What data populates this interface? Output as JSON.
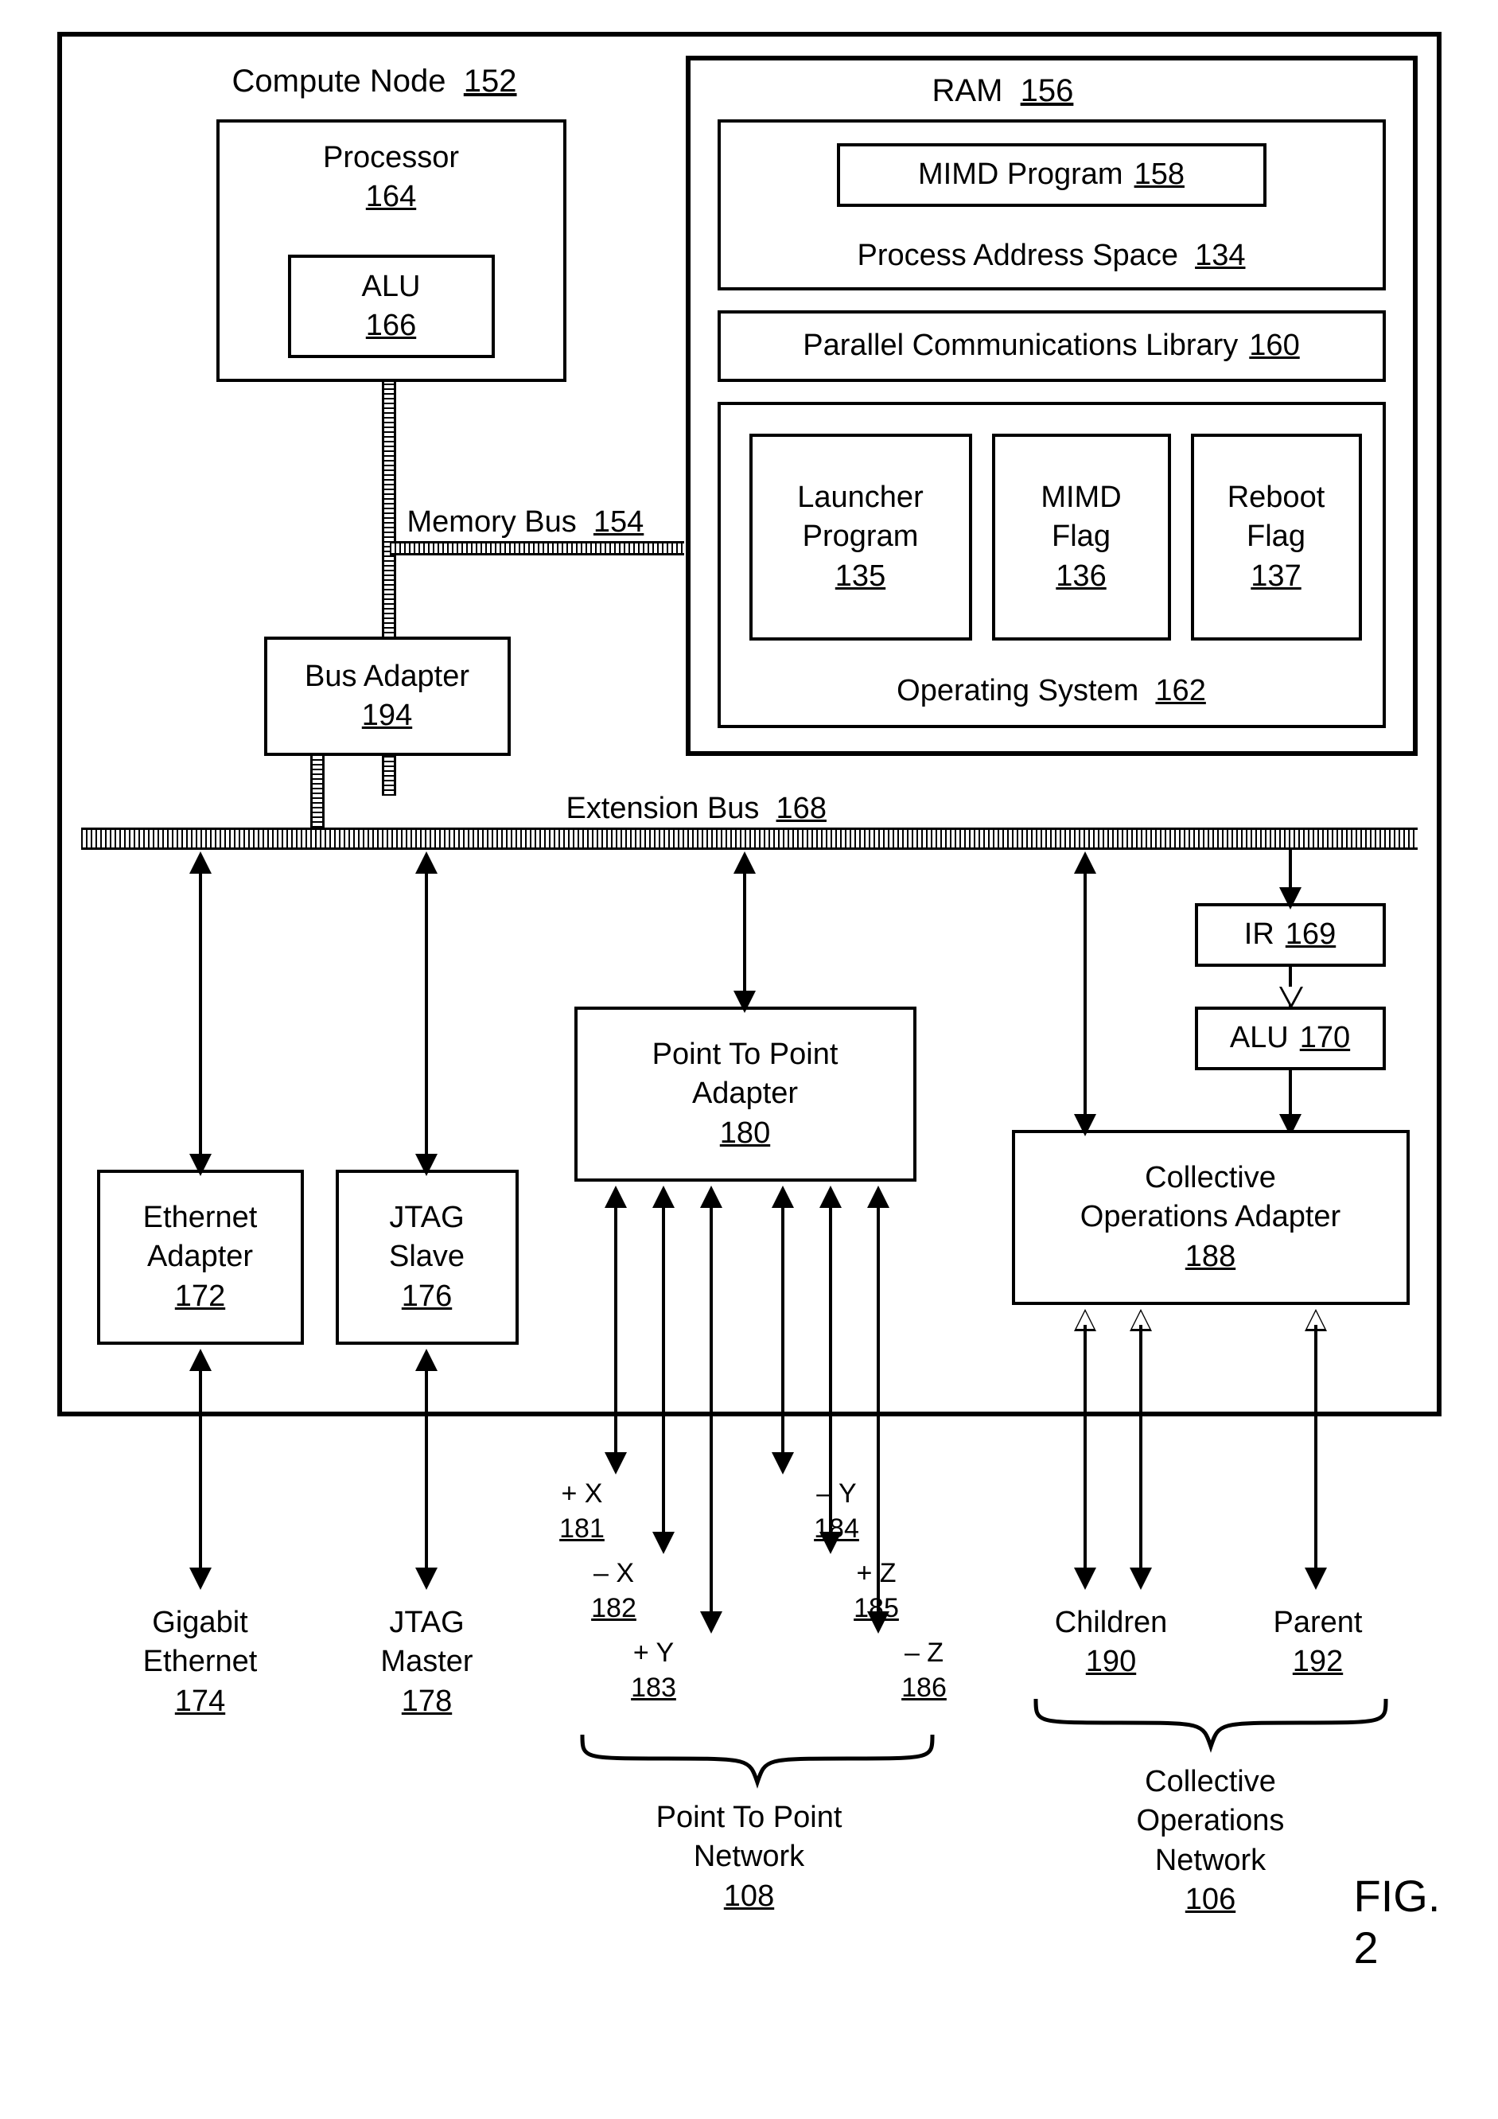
{
  "computeNode": {
    "label": "Compute Node",
    "ref": "152"
  },
  "processor": {
    "label": "Processor",
    "ref": "164"
  },
  "alu1": {
    "label": "ALU",
    "ref": "166"
  },
  "memoryBus": {
    "label": "Memory Bus",
    "ref": "154"
  },
  "busAdapter": {
    "label": "Bus Adapter",
    "ref": "194"
  },
  "ram": {
    "label": "RAM",
    "ref": "156"
  },
  "mimdProgram": {
    "label": "MIMD Program",
    "ref": "158"
  },
  "processAddrSpace": {
    "label": "Process Address Space",
    "ref": "134"
  },
  "parallelCommLib": {
    "label": "Parallel Communications Library",
    "ref": "160"
  },
  "launcherProgram": {
    "label": "Launcher Program",
    "ref": "135"
  },
  "mimdFlag": {
    "label": "MIMD Flag",
    "ref": "136"
  },
  "rebootFlag": {
    "label": "Reboot Flag",
    "ref": "137"
  },
  "operatingSystem": {
    "label": "Operating System",
    "ref": "162"
  },
  "extensionBus": {
    "label": "Extension Bus",
    "ref": "168"
  },
  "ir": {
    "label": "IR",
    "ref": "169"
  },
  "alu2": {
    "label": "ALU",
    "ref": "170"
  },
  "p2pAdapter": {
    "label": "Point To Point Adapter",
    "ref": "180"
  },
  "ethernetAdapter": {
    "label": "Ethernet Adapter",
    "ref": "172"
  },
  "jtagSlave": {
    "label": "JTAG Slave",
    "ref": "176"
  },
  "collOpsAdapter": {
    "label": "Collective Operations Adapter",
    "ref": "188"
  },
  "gigabitEthernet": {
    "label": "Gigabit Ethernet",
    "ref": "174"
  },
  "jtagMaster": {
    "label": "JTAG Master",
    "ref": "178"
  },
  "children": {
    "label": "Children",
    "ref": "190"
  },
  "parent": {
    "label": "Parent",
    "ref": "192"
  },
  "p2pNetwork": {
    "label": "Point To Point Network",
    "ref": "108"
  },
  "collOpsNetwork": {
    "label": "Collective Operations Network",
    "ref": "106"
  },
  "axisPX": {
    "label": "+ X",
    "ref": "181"
  },
  "axisNX": {
    "label": "– X",
    "ref": "182"
  },
  "axisPY": {
    "label": "+ Y",
    "ref": "183"
  },
  "axisNY": {
    "label": "– Y",
    "ref": "184"
  },
  "axisPZ": {
    "label": "+ Z",
    "ref": "185"
  },
  "axisNZ": {
    "label": "– Z",
    "ref": "186"
  },
  "figLabel": "FIG. 2"
}
